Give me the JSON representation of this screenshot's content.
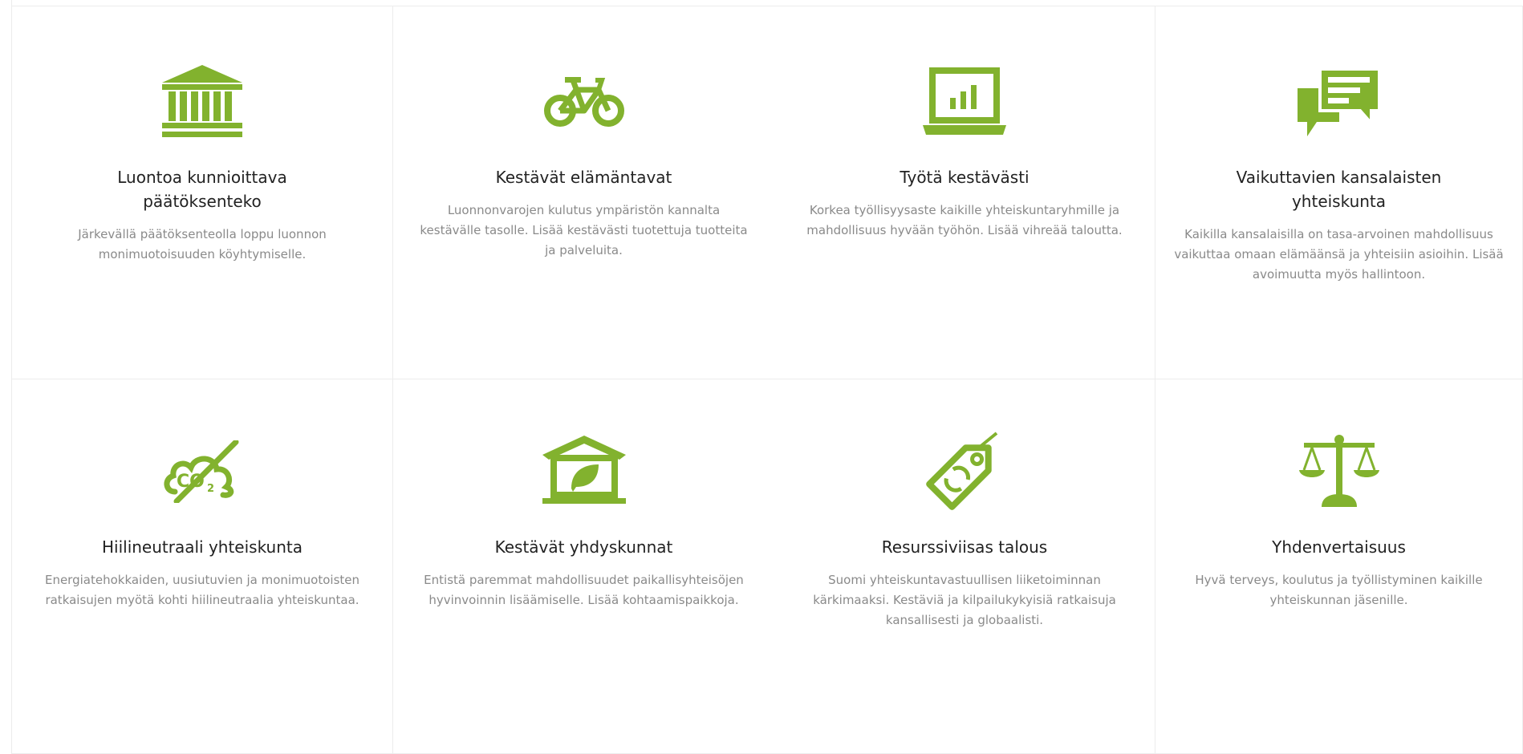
{
  "accent_color": "#82b22e",
  "cards": [
    {
      "icon": "bank-building-icon",
      "title": "Luontoa kunnioittava päätöksenteko",
      "text": "Järkevällä päätöksenteolla loppu luonnon monimuotoisuuden köyhtymiselle."
    },
    {
      "icon": "bicycle-icon",
      "title": "Kestävät elämäntavat",
      "text": "Luonnonvarojen kulutus ympäristön kannalta kestävälle tasolle. Lisää kestävästi tuotettuja tuotteita ja palveluita."
    },
    {
      "icon": "laptop-chart-icon",
      "title": "Työtä kestävästi",
      "text": "Korkea työllisyysaste kaikille yhteiskuntaryhmille ja mahdollisuus hyvään työhön. Lisää vihreää taloutta."
    },
    {
      "icon": "chat-bubbles-icon",
      "title": "Vaikuttavien kansalaisten yhteiskunta",
      "text": "Kaikilla kansalaisilla on tasa-arvoinen mahdollisuus vaikuttaa omaan elämäänsä ja yhteisiin asioihin. Lisää avoimuutta myös hallintoon."
    },
    {
      "icon": "co2-cloud-crossed-icon",
      "title": "Hiilineutraali yhteiskunta",
      "text": "Energiatehokkaiden, uusiutuvien ja monimuotoisten ratkaisujen myötä kohti hiilineutraalia yhteiskuntaa."
    },
    {
      "icon": "house-leaf-icon",
      "title": "Kestävät yhdyskunnat",
      "text": "Entistä paremmat mahdollisuudet paikallisyhteisöjen hyvinvoinnin lisäämiselle. Lisää kohtaamispaikkoja."
    },
    {
      "icon": "recycle-tag-icon",
      "title": "Resurssiviisas talous",
      "text": "Suomi yhteiskuntavastuullisen liiketoiminnan kärkimaaksi. Kestäviä ja kilpailukykyisiä ratkaisuja kansallisesti ja globaalisti."
    },
    {
      "icon": "scales-icon",
      "title": "Yhdenvertaisuus",
      "text": "Hyvä terveys, koulutus ja työllistyminen kaikille yhteiskunnan jäsenille."
    }
  ]
}
